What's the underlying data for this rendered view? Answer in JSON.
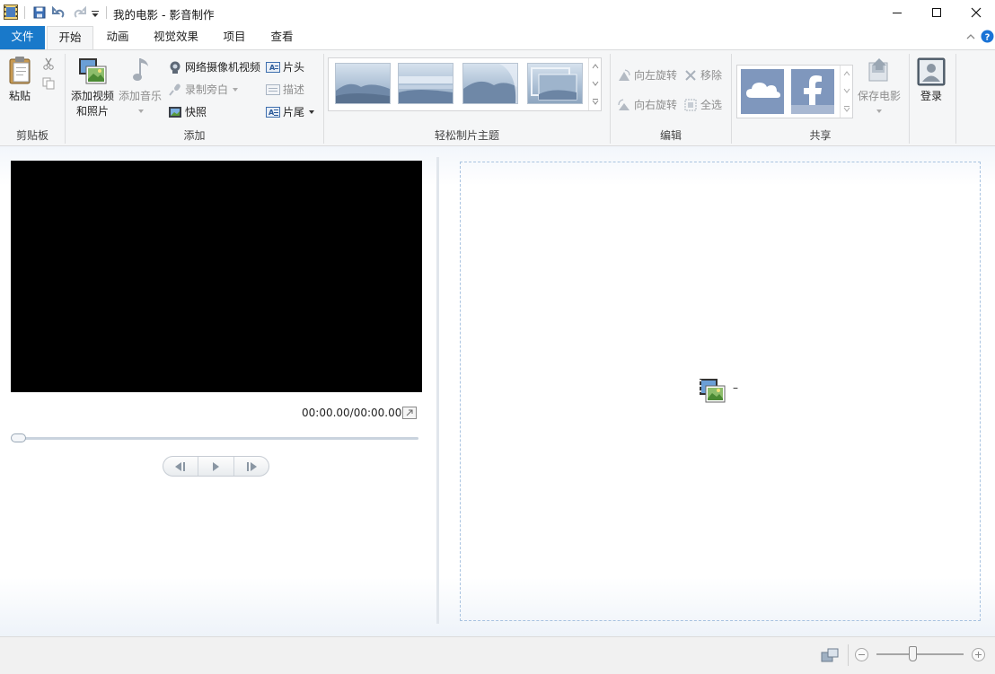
{
  "window": {
    "title": "我的电影 - 影音制作"
  },
  "tabs": {
    "file": "文件",
    "items": [
      "开始",
      "动画",
      "视觉效果",
      "项目",
      "查看"
    ]
  },
  "ribbon": {
    "clipboard": {
      "label": "剪贴板",
      "paste": "粘贴"
    },
    "add": {
      "label": "添加",
      "add_video_line1": "添加视频",
      "add_video_line2": "和照片",
      "add_music": "添加音乐",
      "webcam_video": "网络摄像机视频",
      "record_narration": "录制旁白",
      "snapshot": "快照",
      "title": "片头",
      "caption": "描述",
      "credits": "片尾"
    },
    "themes": {
      "label": "轻松制片主题"
    },
    "edit": {
      "label": "编辑",
      "rotate_left": "向左旋转",
      "rotate_right": "向右旋转",
      "remove": "移除",
      "select_all": "全选"
    },
    "share": {
      "label": "共享",
      "save_movie": "保存电影"
    },
    "account": {
      "sign_in": "登录"
    }
  },
  "preview": {
    "time": "00:00.00/00:00.00",
    "seek_position": 0
  },
  "storyboard": {
    "empty_text": "–"
  },
  "colors": {
    "file_tab": "#1979ca",
    "ribbon_bg": "#f5f6f7",
    "storyboard_border": "#a9c3e0",
    "share_tile": "#7f97bd"
  }
}
